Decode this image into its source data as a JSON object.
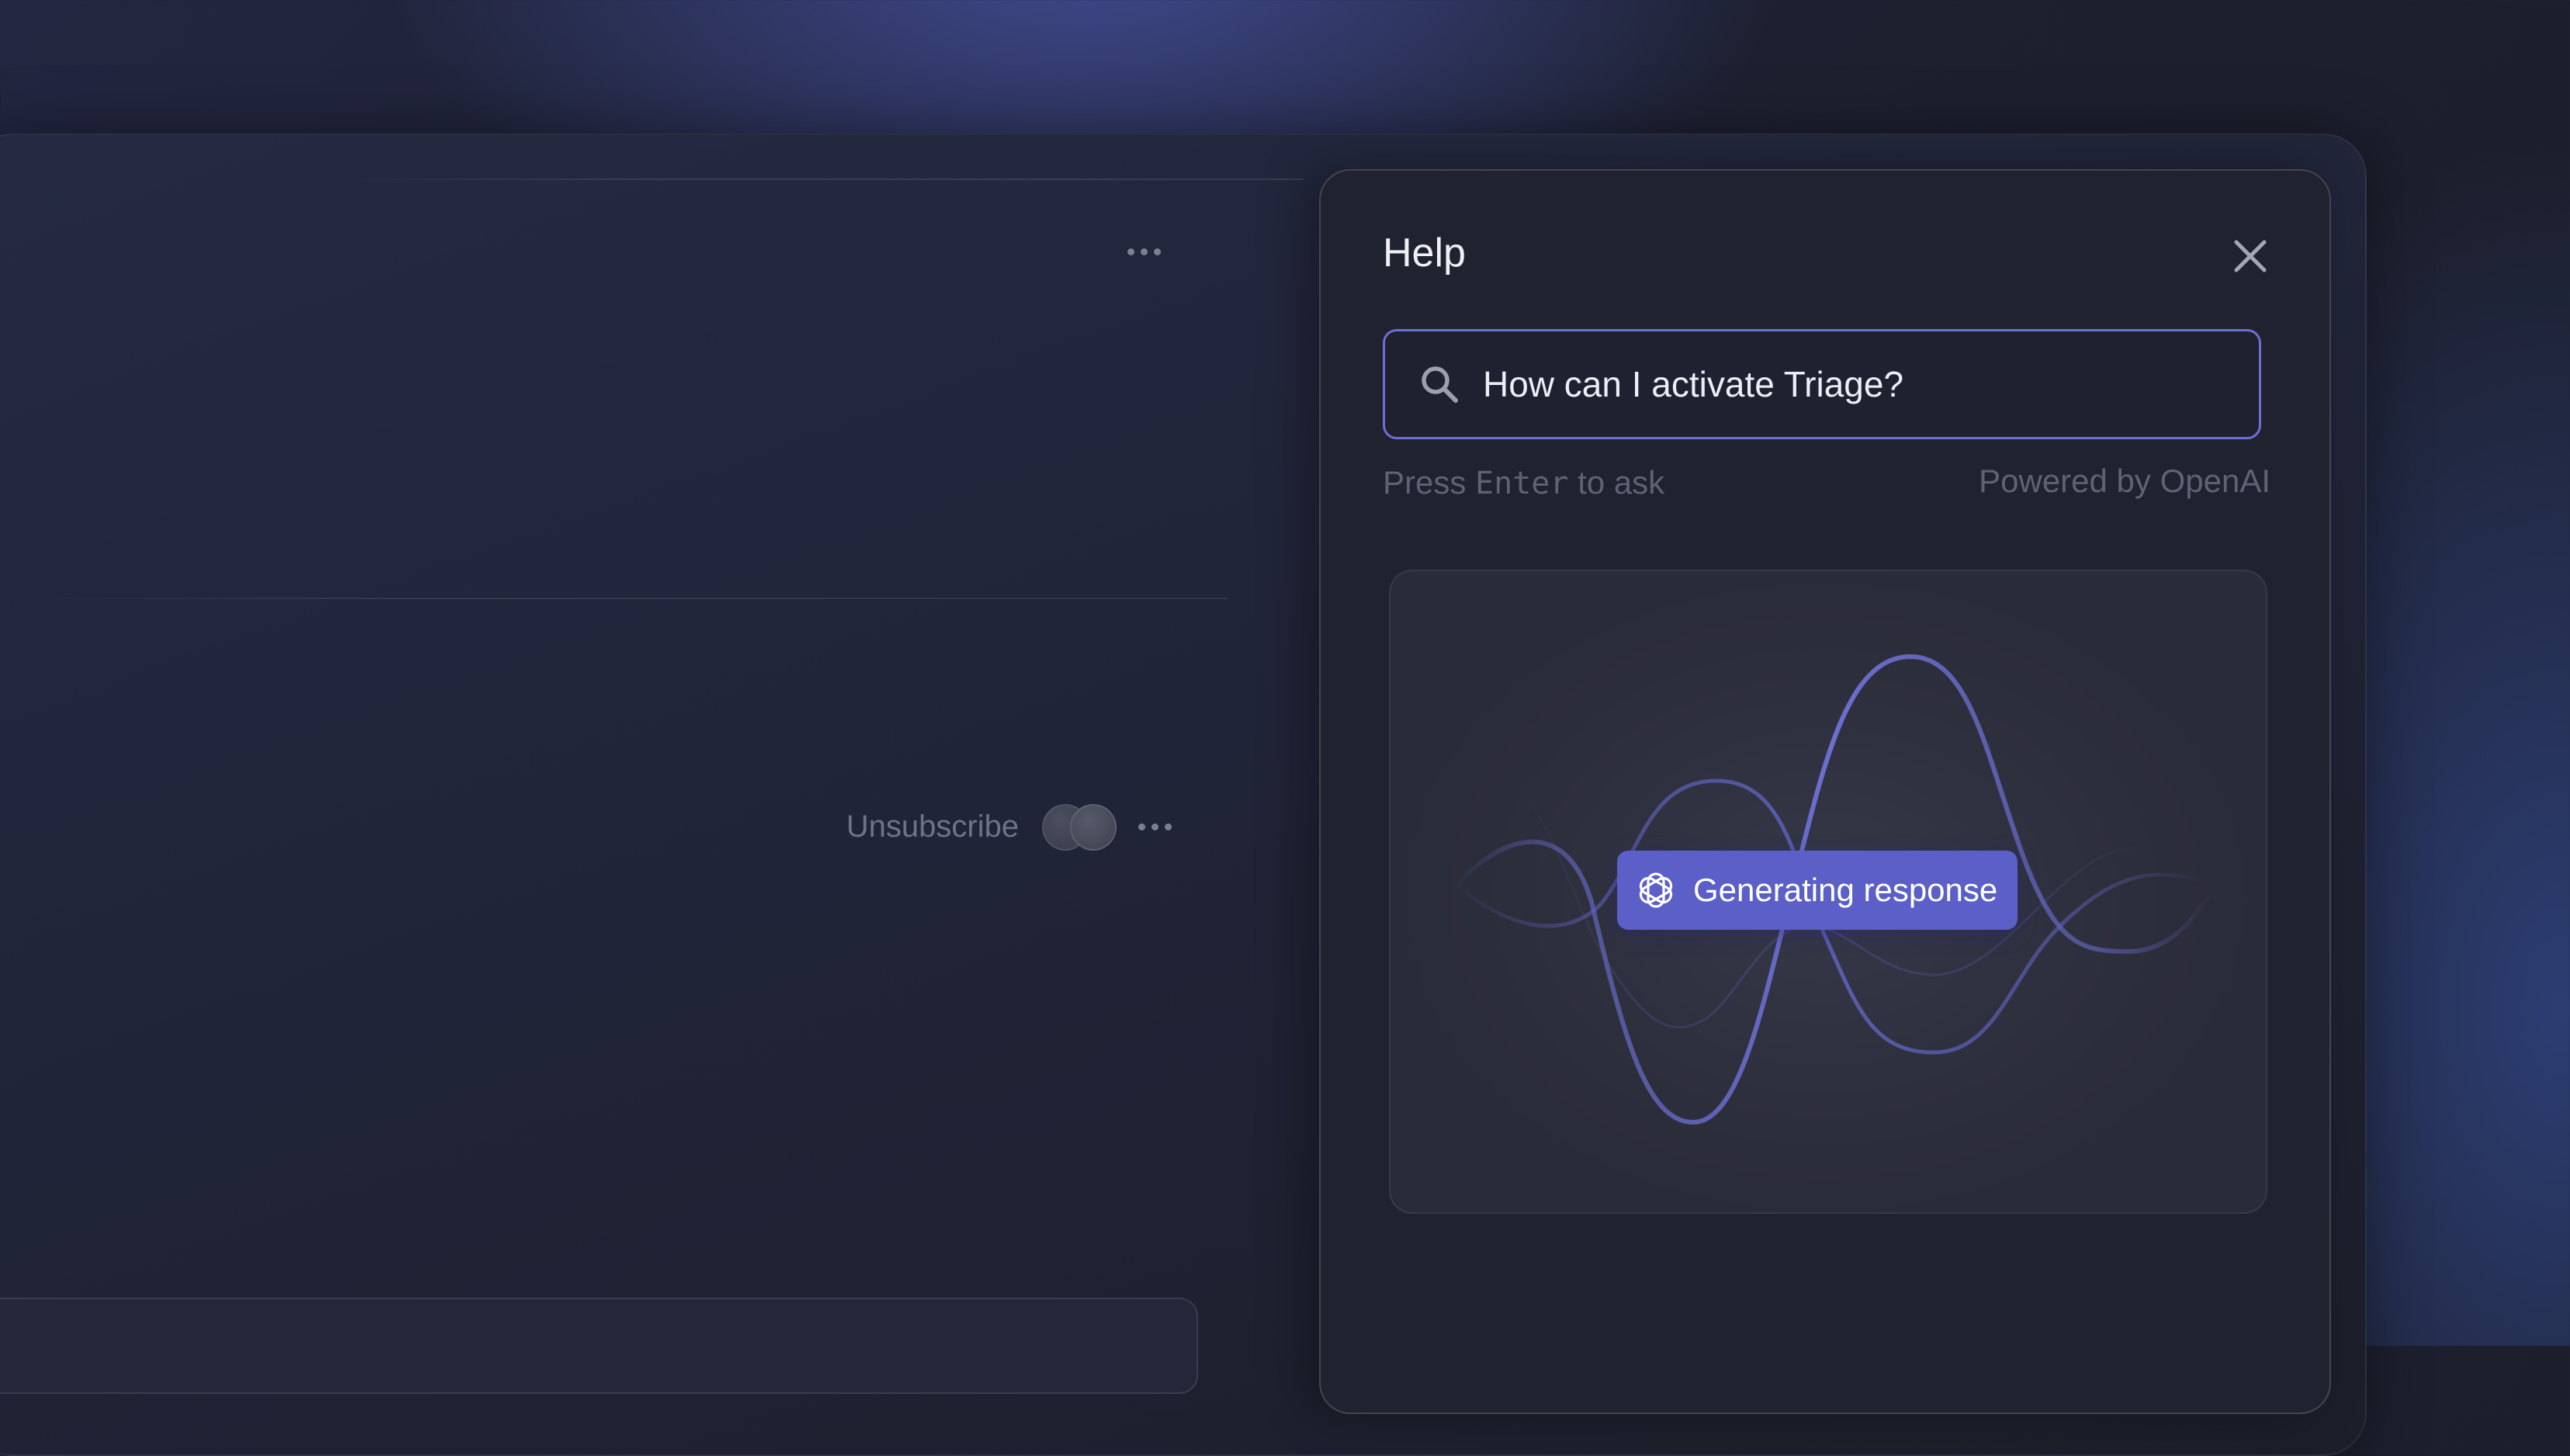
{
  "help_panel": {
    "title": "Help",
    "search": {
      "value": "How can I activate Triage?"
    },
    "hint": {
      "prefix": "Press ",
      "key": "Enter",
      "suffix": " to ask"
    },
    "powered_by": "Powered by OpenAI",
    "status": "Generating response"
  },
  "background_app": {
    "unsubscribe_label": "Unsubscribe"
  },
  "icons": {
    "close": "close-icon",
    "search": "search-icon",
    "openai": "openai-logo-icon",
    "more": "more-horizontal-icon"
  },
  "colors": {
    "accent": "#5b5fc7",
    "focus_border": "#6b70d6",
    "panel_bg": "#21222f",
    "wave": "#6b6fd0"
  }
}
